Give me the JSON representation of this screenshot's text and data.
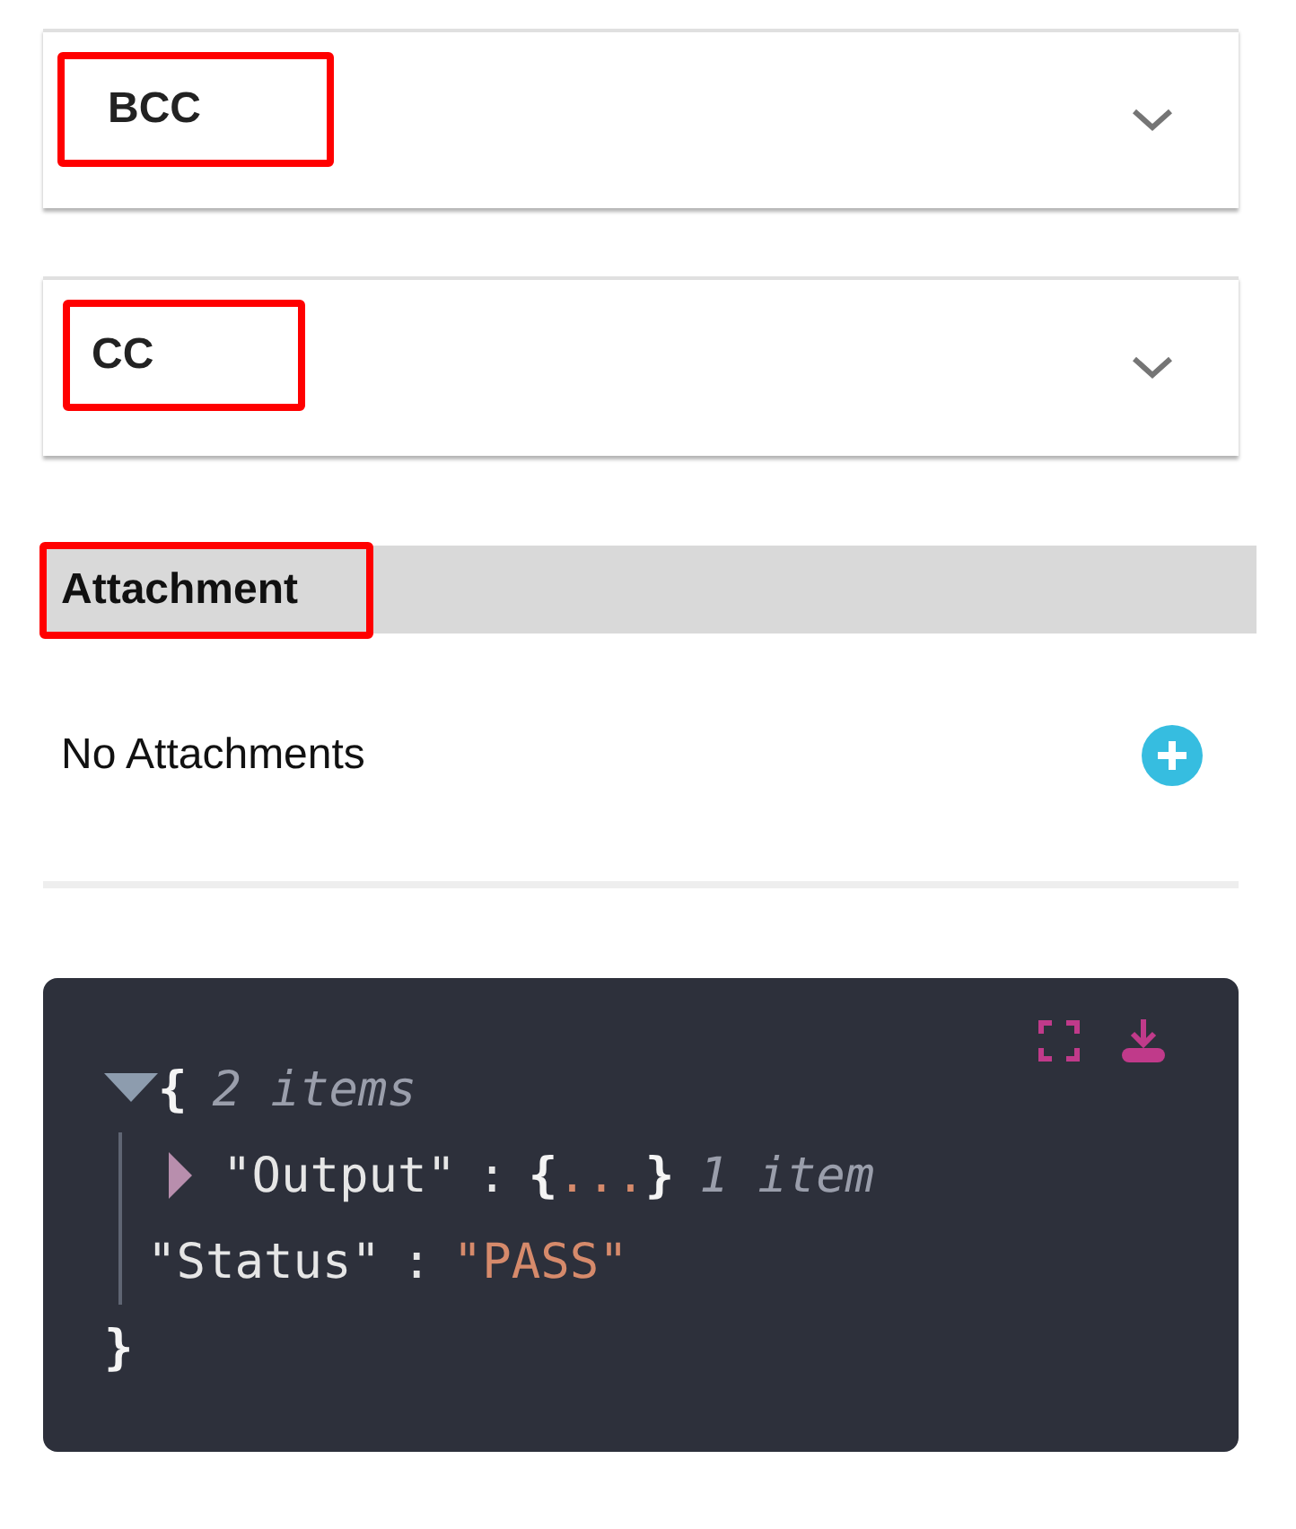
{
  "panels": [
    {
      "title": "BCC",
      "highlighted": true,
      "expanded": false
    },
    {
      "title": "CC",
      "highlighted": true,
      "expanded": false
    }
  ],
  "attachment": {
    "title": "Attachment",
    "highlighted": true,
    "empty_text": "No Attachments"
  },
  "json_viewer": {
    "open": "{",
    "close": "}",
    "expanded": true,
    "count_label": "2 items",
    "children": [
      {
        "kind": "object",
        "key": "\"Output\"",
        "separator": ":",
        "open": "{",
        "ellipsis": "...",
        "close": "}",
        "expanded": false,
        "count_label": "1 item"
      },
      {
        "kind": "string",
        "key": "\"Status\"",
        "separator": ":",
        "value": "\"PASS\""
      }
    ]
  }
}
